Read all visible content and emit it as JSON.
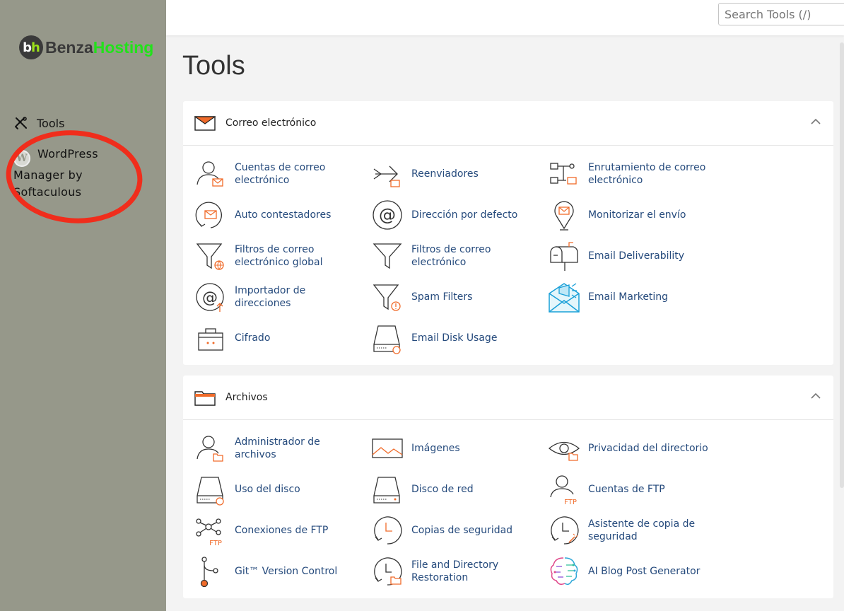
{
  "brand": {
    "logo_badge_b": "b",
    "logo_badge_h": "h",
    "name_part1": "Benza",
    "name_part2": "Hosting"
  },
  "sidebar": {
    "items": [
      {
        "label": "Tools",
        "icon": "tools-icon"
      },
      {
        "label": "WordPress Manager by Softaculous",
        "icon": "wordpress-icon"
      }
    ],
    "annotation_color": "#f02d1c"
  },
  "search": {
    "placeholder": "Search Tools (/)"
  },
  "page_title": "Tools",
  "colors": {
    "accent": "#f06b2a",
    "link": "#254a7c",
    "sidebar": "#96988a"
  },
  "panels": [
    {
      "title": "Correo electrónico",
      "icon": "envelope-icon",
      "items": [
        {
          "label": "Cuentas de correo electrónico",
          "icon": "email-accounts-icon"
        },
        {
          "label": "Reenviadores",
          "icon": "forwarders-icon"
        },
        {
          "label": "Enrutamiento de correo electrónico",
          "icon": "email-routing-icon"
        },
        {
          "label": "Auto contestadores",
          "icon": "autoresponders-icon"
        },
        {
          "label": "Dirección por defecto",
          "icon": "default-address-icon"
        },
        {
          "label": "Monitorizar el envío",
          "icon": "track-delivery-icon"
        },
        {
          "label": "Filtros de correo electrónico global",
          "icon": "global-filters-icon"
        },
        {
          "label": "Filtros de correo electrónico",
          "icon": "email-filters-icon"
        },
        {
          "label": "Email Deliverability",
          "icon": "mailbox-icon"
        },
        {
          "label": "Importador de direcciones",
          "icon": "address-importer-icon"
        },
        {
          "label": "Spam Filters",
          "icon": "spam-filters-icon"
        },
        {
          "label": "Email Marketing",
          "icon": "email-marketing-icon"
        },
        {
          "label": "Cifrado",
          "icon": "encryption-icon"
        },
        {
          "label": "Email Disk Usage",
          "icon": "email-disk-usage-icon"
        }
      ]
    },
    {
      "title": "Archivos",
      "icon": "folder-icon",
      "items": [
        {
          "label": "Administrador de archivos",
          "icon": "file-manager-icon"
        },
        {
          "label": "Imágenes",
          "icon": "images-icon"
        },
        {
          "label": "Privacidad del directorio",
          "icon": "directory-privacy-icon"
        },
        {
          "label": "Uso del disco",
          "icon": "disk-usage-icon"
        },
        {
          "label": "Disco de red",
          "icon": "web-disk-icon"
        },
        {
          "label": "Cuentas de FTP",
          "icon": "ftp-accounts-icon"
        },
        {
          "label": "Conexiones de FTP",
          "icon": "ftp-connections-icon"
        },
        {
          "label": "Copias de seguridad",
          "icon": "backup-icon"
        },
        {
          "label": "Asistente de copia de seguridad",
          "icon": "backup-wizard-icon"
        },
        {
          "label": "Git™ Version Control",
          "icon": "git-icon"
        },
        {
          "label": "File and Directory Restoration",
          "icon": "restoration-icon"
        },
        {
          "label": "AI Blog Post Generator",
          "icon": "ai-brain-icon"
        }
      ]
    }
  ]
}
